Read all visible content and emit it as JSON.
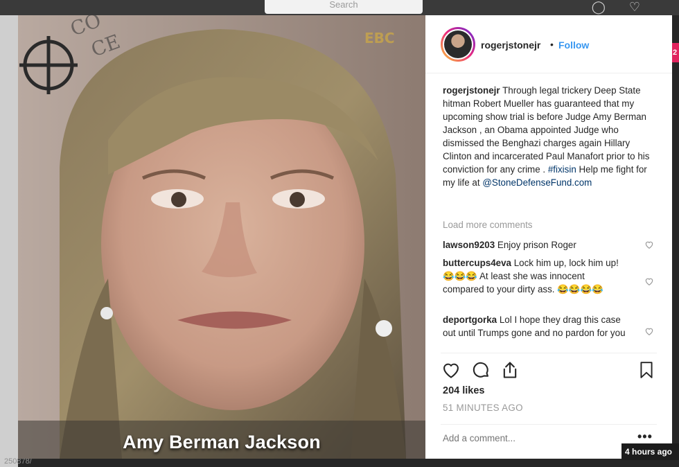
{
  "background": {
    "search_placeholder": "Search",
    "bottom_left_text": "250878/",
    "right_badge": "2",
    "time_badge": "4 hours ago"
  },
  "photo": {
    "caption": "Amy Berman Jackson",
    "watermark": "EBC"
  },
  "post": {
    "username": "rogerjstonejr",
    "dot": "•",
    "follow_label": "Follow",
    "caption_user": "rogerjstonejr",
    "caption_text": "Through legal trickery Deep State hitman Robert Mueller has guaranteed that my upcoming show trial is before Judge Amy Berman Jackson , an Obama appointed Judge who dismissed the Benghazi charges again Hillary Clinton and incarcerated Paul Manafort prior to his conviction for any crime .",
    "hashtag": "#fixisin",
    "caption_tail": "Help me fight for my life at",
    "mention": "@StoneDefenseFund.com",
    "load_more": "Load more comments",
    "comments": [
      {
        "user": "lawson9203",
        "text": "Enjoy prison Roger"
      },
      {
        "user": "buttercups4eva",
        "text": "Lock him up, lock him up! 😂😂😂 At least she was innocent compared to your dirty ass. 😂😂😂😂"
      },
      {
        "user": "deportgorka",
        "text": "Lol I hope they drag this case out until Trumps gone and no pardon for you"
      }
    ],
    "likes": "204 likes",
    "time_ago": "51 MINUTES AGO",
    "add_comment_placeholder": "Add a comment...",
    "more_label": "•••"
  },
  "icons": {
    "like": "heart-icon",
    "comment": "comment-icon",
    "share": "share-icon",
    "save": "bookmark-icon"
  },
  "colors": {
    "link": "#003569",
    "follow": "#3897f0",
    "muted": "#999999"
  }
}
